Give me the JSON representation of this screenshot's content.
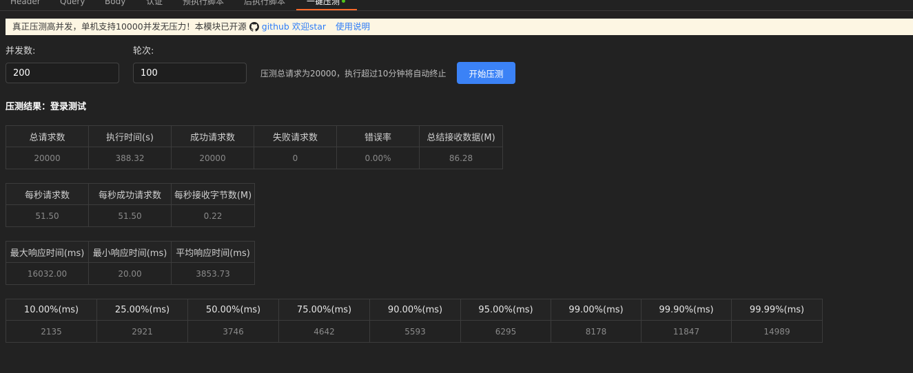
{
  "tabs": [
    {
      "label": "Header"
    },
    {
      "label": "Query"
    },
    {
      "label": "Body"
    },
    {
      "label": "认证"
    },
    {
      "label": "预执行脚本"
    },
    {
      "label": "后执行脚本"
    },
    {
      "label": "一键压测"
    }
  ],
  "colors": {
    "active_tab_underline": "#ff6a2a",
    "status_dot": "#52c41a",
    "primary_button": "#3b82f6",
    "link": "#2d7cf7",
    "notice_bg": "#fdf6e3"
  },
  "notice": {
    "text": "真正压测高并发，单机支持10000并发无压力！本模块已开源",
    "icon": "github-icon",
    "github_link": "github 欢迎star",
    "usage_link": "使用说明"
  },
  "form": {
    "concurrency_label": "并发数:",
    "concurrency_value": "200",
    "rounds_label": "轮次:",
    "rounds_value": "100",
    "hint": "压测总请求为20000，执行超过10分钟将自动终止",
    "start_button": "开始压测"
  },
  "result_title": "压测结果：登录测试",
  "table1": {
    "headers": [
      "总请求数",
      "执行时间(s)",
      "成功请求数",
      "失败请求数",
      "错误率",
      "总结接收数据(M)"
    ],
    "values": [
      "20000",
      "388.32",
      "20000",
      "0",
      "0.00%",
      "86.28"
    ]
  },
  "table2": {
    "headers": [
      "每秒请求数",
      "每秒成功请求数",
      "每秒接收字节数(M)"
    ],
    "values": [
      "51.50",
      "51.50",
      "0.22"
    ]
  },
  "table3": {
    "headers": [
      "最大响应时间(ms)",
      "最小响应时间(ms)",
      "平均响应时间(ms)"
    ],
    "values": [
      "16032.00",
      "20.00",
      "3853.73"
    ]
  },
  "table4": {
    "headers": [
      "10.00%(ms)",
      "25.00%(ms)",
      "50.00%(ms)",
      "75.00%(ms)",
      "90.00%(ms)",
      "95.00%(ms)",
      "99.00%(ms)",
      "99.90%(ms)",
      "99.99%(ms)"
    ],
    "values": [
      "2135",
      "2921",
      "3746",
      "4642",
      "5593",
      "6295",
      "8178",
      "11847",
      "14989"
    ]
  }
}
